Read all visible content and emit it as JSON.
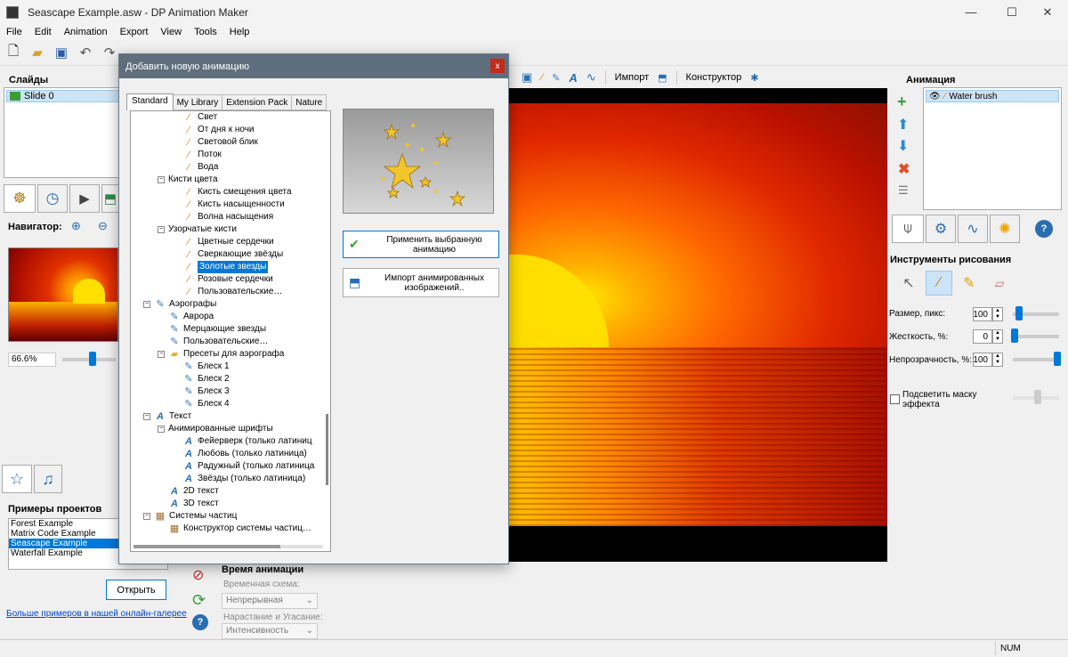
{
  "window": {
    "title": "Seascape Example.asw - DP Animation Maker",
    "minimize": "—",
    "maximize": "☐",
    "close": "✕"
  },
  "menu": [
    "File",
    "Edit",
    "Animation",
    "Export",
    "View",
    "Tools",
    "Help"
  ],
  "editor_toolbar": {
    "import_label": "Импорт",
    "constructor_label": "Конструктор"
  },
  "slides": {
    "header": "Слайды",
    "items": [
      "Slide 0"
    ]
  },
  "navigator": {
    "label": "Навигатор:",
    "zoom": "66.6%"
  },
  "examples": {
    "header": "Примеры проектов",
    "items": [
      "Forest Example",
      "Matrix Code Example",
      "Seascape Example",
      "Waterfall Example"
    ],
    "selected_index": 2,
    "open_button": "Открыть",
    "gallery_link": "Больше примеров в нашей онлайн-галерее"
  },
  "timing": {
    "header": "Время анимации",
    "scheme_label": "Временная схема:",
    "scheme_value": "Непрерывная",
    "fade_label": "Нарастание и Угасание:",
    "fade_value": "Интенсивность"
  },
  "animation": {
    "header": "Анимация",
    "items": [
      "Water brush"
    ]
  },
  "drawing": {
    "header": "Инструменты рисования",
    "size_label": "Размер, пикс:",
    "size_value": "100",
    "size_level": 0.1,
    "hardness_label": "Жесткость, %:",
    "hardness_value": "0",
    "hardness_level": 0.0,
    "opacity_label": "Непрозрачность, %:",
    "opacity_value": "100",
    "opacity_level": 1.0,
    "highlight_label": "Подсветить маску эффекта"
  },
  "status": {
    "num": "NUM"
  },
  "dialog": {
    "title": "Добавить новую анимацию",
    "close": "x",
    "tabs": [
      "Standard",
      "My Library",
      "Extension Pack",
      "Nature"
    ],
    "apply_button": "Применить выбранную анимацию",
    "import_button": "Импорт анимированных изображений..",
    "tree": [
      {
        "level": 3,
        "text": "Свет",
        "icon": "brush-icon"
      },
      {
        "level": 3,
        "text": "От дня к ночи",
        "icon": "brush-icon"
      },
      {
        "level": 3,
        "text": "Световой блик",
        "icon": "brush-icon"
      },
      {
        "level": 3,
        "text": "Поток",
        "icon": "brush-icon"
      },
      {
        "level": 3,
        "text": "Вода",
        "icon": "brush-icon"
      },
      {
        "level": 2,
        "text": "Кисти цвета",
        "icon": "",
        "exp": "−"
      },
      {
        "level": 3,
        "text": "Кисть смещения цвета",
        "icon": "brush-icon"
      },
      {
        "level": 3,
        "text": "Кисть насыщенности",
        "icon": "brush-icon"
      },
      {
        "level": 3,
        "text": "Волна насыщения",
        "icon": "brush-icon"
      },
      {
        "level": 2,
        "text": "Узорчатые кисти",
        "icon": "",
        "exp": "−"
      },
      {
        "level": 3,
        "text": "Цветные сердечки",
        "icon": "brush-icon"
      },
      {
        "level": 3,
        "text": "Сверкающие звёзды",
        "icon": "brush-icon"
      },
      {
        "level": 3,
        "text": "Золотые звезды",
        "icon": "brush-icon",
        "selected": true
      },
      {
        "level": 3,
        "text": "Розовые сердечки",
        "icon": "brush-icon"
      },
      {
        "level": 3,
        "text": "Пользовательские…",
        "icon": "brush-icon"
      },
      {
        "level": 1,
        "text": "Аэрографы",
        "icon": "airbrush-icon",
        "exp": "−"
      },
      {
        "level": 2,
        "text": "Аврора",
        "icon": "airbrush-icon"
      },
      {
        "level": 2,
        "text": "Мерцающие звезды",
        "icon": "airbrush-icon"
      },
      {
        "level": 2,
        "text": "Пользовательские…",
        "icon": "airbrush-icon"
      },
      {
        "level": 2,
        "text": "Пресеты для аэрографа",
        "icon": "folder-icon",
        "exp": "−"
      },
      {
        "level": 3,
        "text": "Блеск 1",
        "icon": "airbrush-icon"
      },
      {
        "level": 3,
        "text": "Блеск 2",
        "icon": "airbrush-icon"
      },
      {
        "level": 3,
        "text": "Блеск 3",
        "icon": "airbrush-icon"
      },
      {
        "level": 3,
        "text": "Блеск 4",
        "icon": "airbrush-icon"
      },
      {
        "level": 1,
        "text": "Текст",
        "icon": "text-icon",
        "exp": "−"
      },
      {
        "level": 2,
        "text": "Анимированные шрифты",
        "icon": "",
        "exp": "−"
      },
      {
        "level": 3,
        "text": "Фейерверк (только латиниц",
        "icon": "text-icon"
      },
      {
        "level": 3,
        "text": "Любовь (только латиница)",
        "icon": "text-icon"
      },
      {
        "level": 3,
        "text": "Радужный (только латиница",
        "icon": "text-icon"
      },
      {
        "level": 3,
        "text": "Звёзды (только латиница)",
        "icon": "text-icon"
      },
      {
        "level": 2,
        "text": "2D текст",
        "icon": "text-icon"
      },
      {
        "level": 2,
        "text": "3D текст",
        "icon": "text-icon"
      },
      {
        "level": 1,
        "text": "Системы частиц",
        "icon": "particles-icon",
        "exp": "−"
      },
      {
        "level": 2,
        "text": "Конструктор системы частиц…",
        "icon": "particles-icon"
      }
    ]
  }
}
